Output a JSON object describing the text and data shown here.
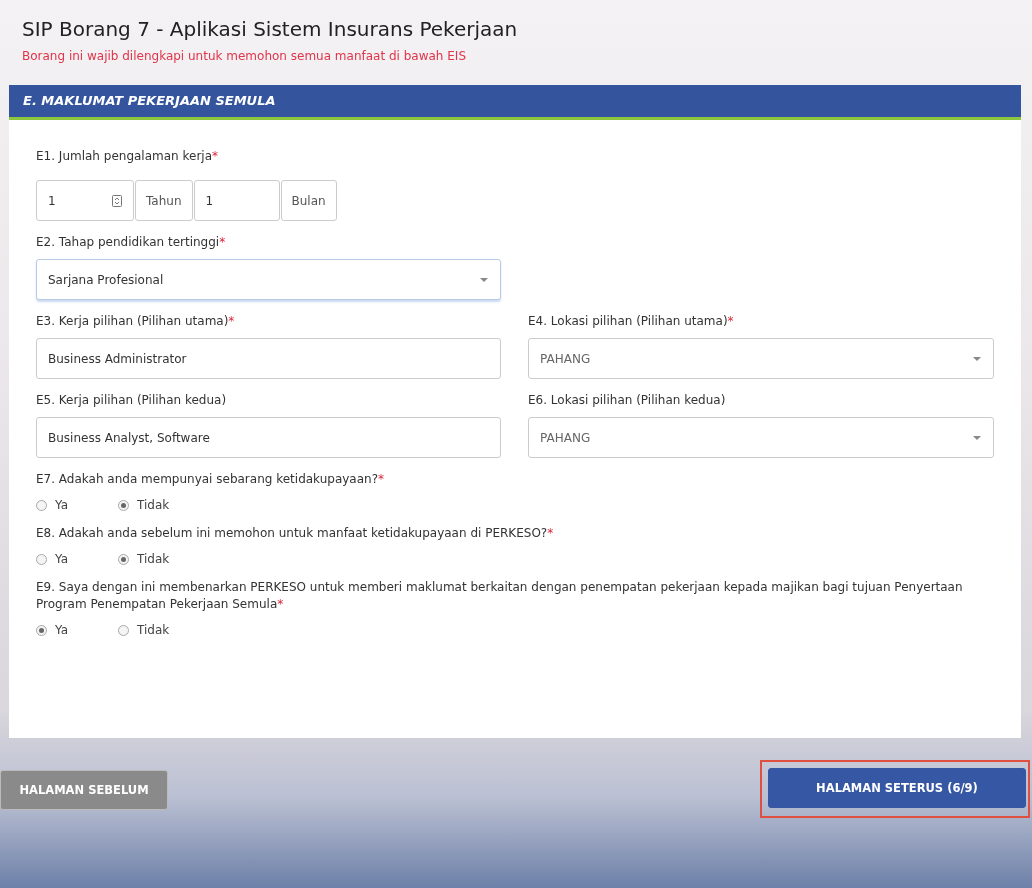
{
  "page": {
    "title": "SIP Borang 7 - Aplikasi Sistem Insurans Pekerjaan",
    "subtitle": "Borang ini wajib dilengkapi untuk memohon semua manfaat di bawah EIS"
  },
  "section": {
    "title": "E. MAKLUMAT PEKERJAAN SEMULA"
  },
  "rows": [
    {
      "questions": [
        {
          "kind": "duration",
          "label": "E1. Jumlah pengalaman kerja",
          "required_mark": "*",
          "parts": [
            {
              "value": "1",
              "unit": "Tahun",
              "spinner": true
            },
            {
              "value": "1",
              "unit": "Bulan",
              "spinner": false
            }
          ]
        }
      ]
    },
    {
      "questions": [
        {
          "kind": "select",
          "label": "E2. Tahap pendidikan tertinggi",
          "required_mark": "*",
          "value": "Sarjana Profesional",
          "focused": true,
          "muted": false
        }
      ]
    },
    {
      "questions": [
        {
          "kind": "text",
          "label": "E3. Kerja pilihan (Pilihan utama)",
          "required_mark": "*",
          "value": "Business Administrator"
        },
        {
          "kind": "select",
          "label": "E4. Lokasi pilihan (Pilihan utama)",
          "required_mark": "*",
          "value": "PAHANG",
          "focused": false,
          "muted": true
        }
      ]
    },
    {
      "questions": [
        {
          "kind": "text",
          "label": "E5. Kerja pilihan (Pilihan kedua)",
          "value": "Business Analyst, Software"
        },
        {
          "kind": "select",
          "label": "E6. Lokasi pilihan (Pilihan kedua)",
          "value": "PAHANG",
          "focused": false,
          "muted": true
        }
      ]
    },
    {
      "questions": [
        {
          "kind": "radio",
          "label": "E7. Adakah anda mempunyai sebarang ketidakupayaan?",
          "required_mark": "*",
          "options": [
            {
              "label": "Ya",
              "selected": false
            },
            {
              "label": "Tidak",
              "selected": true
            }
          ]
        }
      ]
    },
    {
      "questions": [
        {
          "kind": "radio",
          "label": "E8. Adakah anda sebelum ini memohon untuk manfaat ketidakupayaan di PERKESO?",
          "required_mark": "*",
          "options": [
            {
              "label": "Ya",
              "selected": false
            },
            {
              "label": "Tidak",
              "selected": true
            }
          ]
        }
      ]
    },
    {
      "questions": [
        {
          "kind": "radio",
          "label": "E9. Saya dengan ini membenarkan PERKESO untuk memberi maklumat berkaitan dengan penempatan pekerjaan kepada majikan bagi tujuan Penyertaan Program Penempatan Pekerjaan Semula",
          "required_mark": "*",
          "options": [
            {
              "label": "Ya",
              "selected": true
            },
            {
              "label": "Tidak",
              "selected": false
            }
          ]
        }
      ]
    }
  ],
  "buttons": [
    {
      "kind": "previous",
      "label": "HALAMAN SEBELUM",
      "highlighted": false
    },
    {
      "kind": "next",
      "label": "HALAMAN SETERUS (6/9)",
      "highlighted": true
    }
  ]
}
